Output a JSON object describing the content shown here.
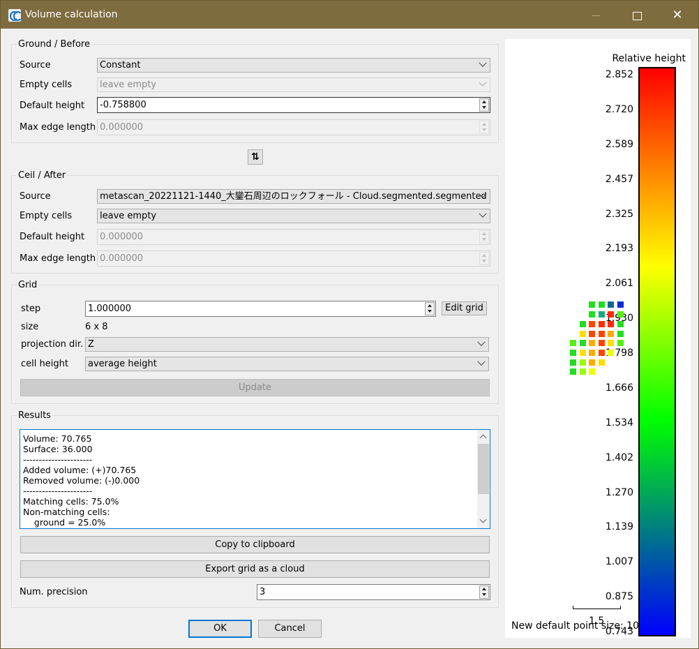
{
  "window": {
    "title": "Volume calculation",
    "minimize_icon": "minimize-icon",
    "maximize_icon": "maximize-icon",
    "close_icon": "close-icon",
    "close_glyph": "✕"
  },
  "ground": {
    "title": "Ground / Before",
    "source_label": "Source",
    "source_value": "Constant",
    "empty_cells_label": "Empty cells",
    "empty_cells_value": "leave empty",
    "default_height_label": "Default height",
    "default_height_value": "-0.758800",
    "max_edge_label": "Max edge length",
    "max_edge_value": "0.000000"
  },
  "swap_button": {
    "glyph": "⇅",
    "icon": "swap-icon"
  },
  "ceil": {
    "title": "Ceil / After",
    "source_label": "Source",
    "source_value": "metascan_20221121-1440_大鑾石周辺のロックフォール - Cloud.segmented.segmented",
    "empty_cells_label": "Empty cells",
    "empty_cells_value": "leave empty",
    "default_height_label": "Default height",
    "default_height_value": "0.000000",
    "max_edge_label": "Max edge length",
    "max_edge_value": "0.000000"
  },
  "grid": {
    "title": "Grid",
    "step_label": "step",
    "step_value": "1.000000",
    "edit_grid_label": "Edit grid",
    "size_label": "size",
    "size_value": "6 x 8",
    "projection_label": "projection dir.",
    "projection_value": "Z",
    "cell_height_label": "cell height",
    "cell_height_value": "average height",
    "update_label": "Update"
  },
  "results": {
    "title": "Results",
    "lines": [
      "Volume: 70.765",
      "Surface: 36.000",
      "----------------------",
      "Added volume: (+)70.765",
      "Removed volume: (-)0.000",
      "----------------------",
      "Matching cells: 75.0%",
      "Non-matching cells:",
      "    ground = 25.0%"
    ],
    "copy_label": "Copy to clipboard",
    "export_label": "Export grid as a cloud",
    "precision_label": "Num. precision",
    "precision_value": "3"
  },
  "buttons": {
    "ok": "OK",
    "cancel": "Cancel"
  },
  "viewer": {
    "scale_title": "Relative height",
    "ticks": [
      "2.852",
      "2.720",
      "2.589",
      "2.457",
      "2.325",
      "2.193",
      "2.061",
      "1.930",
      "1.798",
      "1.666",
      "1.534",
      "1.402",
      "1.270",
      "1.139",
      "1.007",
      "0.875",
      "0.743"
    ],
    "scale_bar_label": "1.5",
    "message": "New default point size: 10",
    "colors": {
      "max": "#ff0000",
      "mid_high": "#ffff00",
      "mid_low": "#00ff00",
      "min": "#0000ff"
    }
  }
}
